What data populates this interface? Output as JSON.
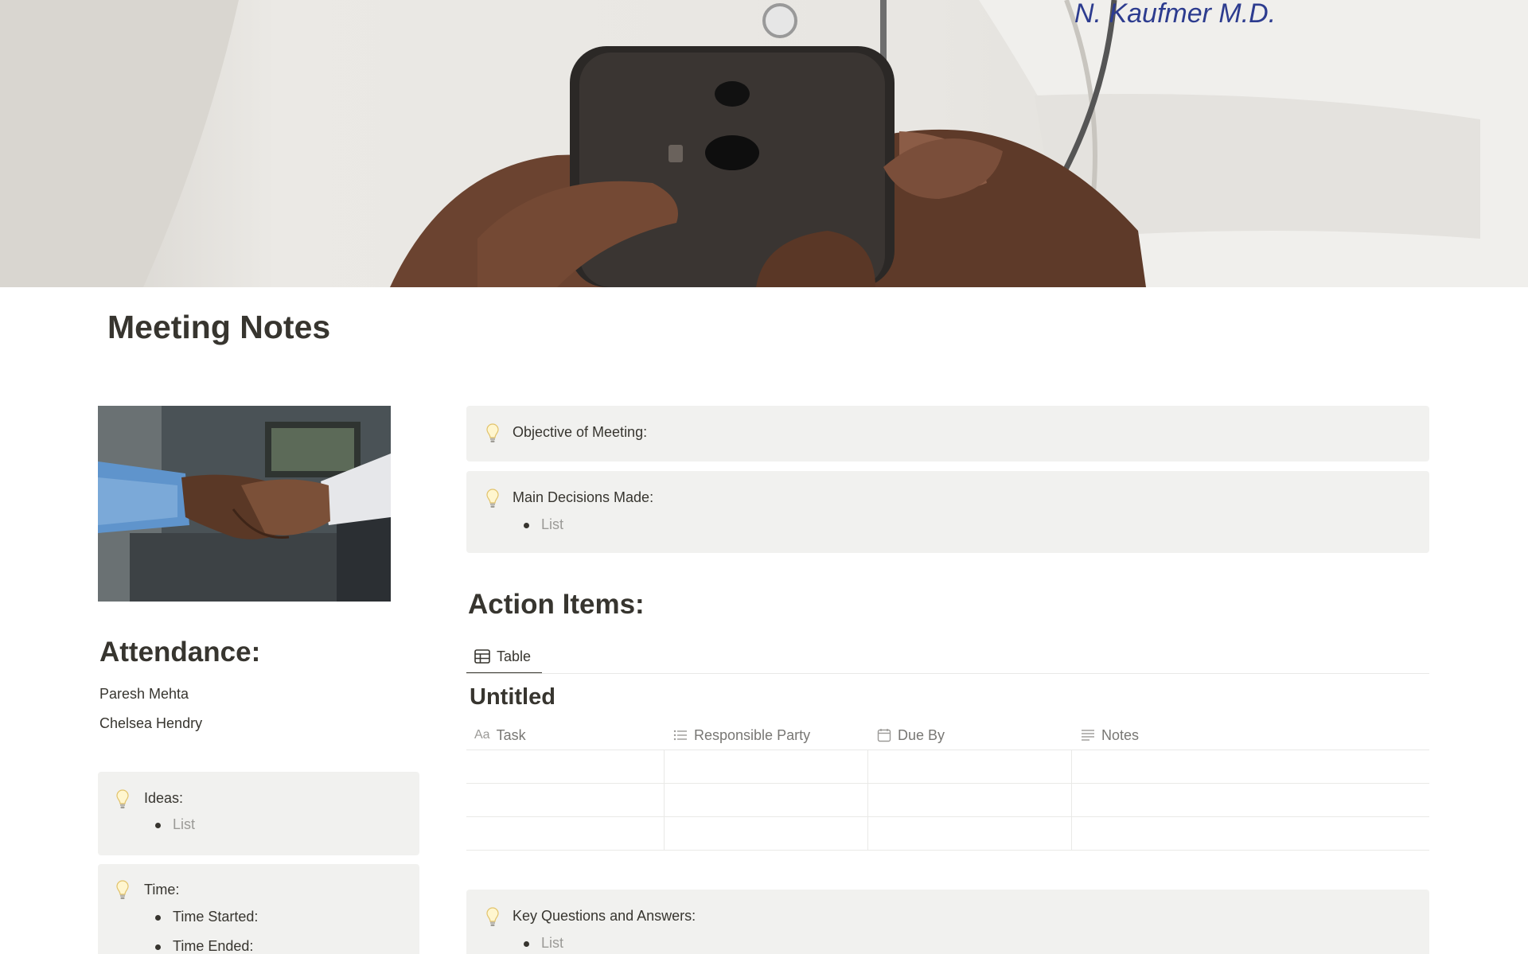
{
  "page": {
    "title": "Meeting Notes"
  },
  "attendance": {
    "heading": "Attendance:",
    "people": [
      "Paresh Mehta",
      "Chelsea Hendry"
    ]
  },
  "callouts": {
    "ideas": {
      "title": "Ideas:",
      "items": [
        "List"
      ]
    },
    "time": {
      "title": "Time:",
      "items": [
        "Time Started:",
        "Time Ended:"
      ]
    },
    "objective": {
      "title": "Objective of Meeting:"
    },
    "decisions": {
      "title": "Main Decisions Made:",
      "items": [
        "List"
      ]
    },
    "questions": {
      "title": "Key Questions and Answers:",
      "items": [
        "List"
      ]
    }
  },
  "action_items": {
    "heading": "Action Items:",
    "view_tab": {
      "label": "Table",
      "icon": "table-icon"
    },
    "database_title": "Untitled",
    "columns": [
      {
        "label": "Task",
        "icon": "aa-title-icon"
      },
      {
        "label": "Responsible Party",
        "icon": "list-icon"
      },
      {
        "label": "Due By",
        "icon": "calendar-icon"
      },
      {
        "label": "Notes",
        "icon": "text-lines-icon"
      }
    ],
    "rows": [
      [
        "",
        "",
        "",
        ""
      ],
      [
        "",
        "",
        "",
        ""
      ],
      [
        "",
        "",
        "",
        ""
      ]
    ]
  },
  "icons": {
    "callout": "lightbulb-icon"
  },
  "colors": {
    "text": "#37352f",
    "muted": "#787774",
    "placeholder": "#9b9a97",
    "callout_bg": "#f1f1ef",
    "divider": "#e9e9e7"
  }
}
